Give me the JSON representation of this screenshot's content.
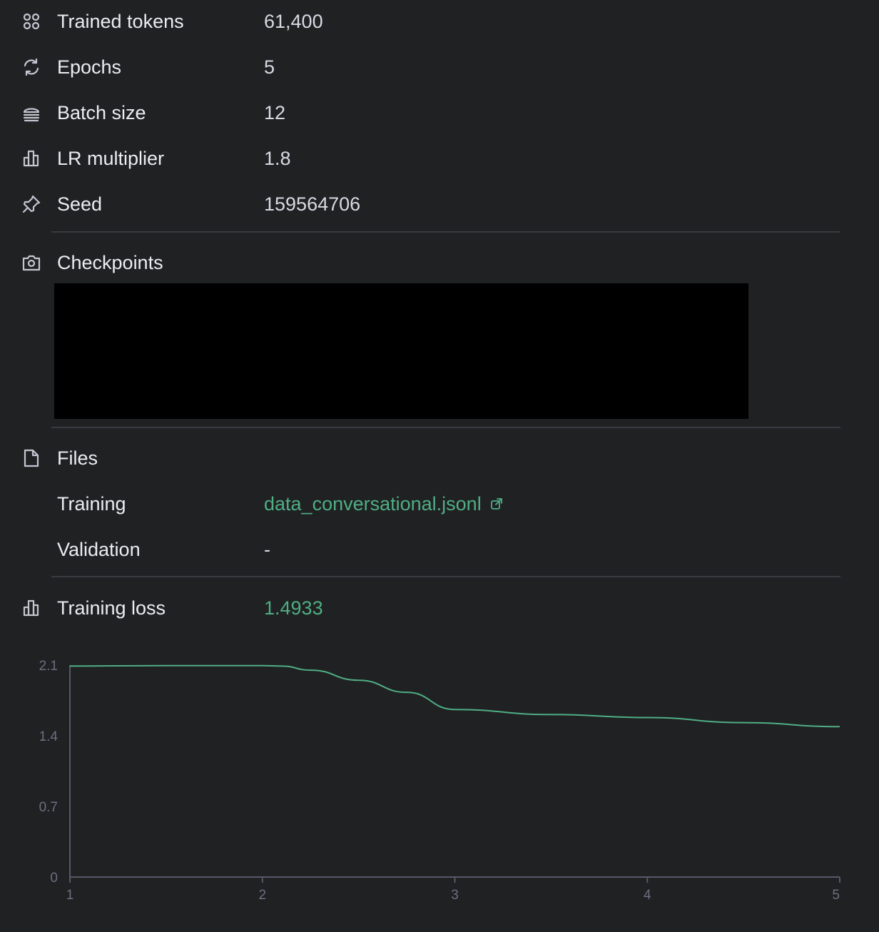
{
  "hyperparameters": {
    "trained_tokens": {
      "label": "Trained tokens",
      "value": "61,400",
      "icon": "grid-dots-icon"
    },
    "epochs": {
      "label": "Epochs",
      "value": "5",
      "icon": "refresh-icon"
    },
    "batch_size": {
      "label": "Batch size",
      "value": "12",
      "icon": "stack-icon"
    },
    "lr_multiplier": {
      "label": "LR multiplier",
      "value": "1.8",
      "icon": "bar-chart-icon"
    },
    "seed": {
      "label": "Seed",
      "value": "159564706",
      "icon": "pin-icon"
    }
  },
  "checkpoints": {
    "label": "Checkpoints",
    "icon": "camera-icon"
  },
  "files": {
    "label": "Files",
    "icon": "file-icon",
    "training_label": "Training",
    "training_file": "data_conversational.jsonl",
    "validation_label": "Validation",
    "validation_value": "-"
  },
  "training_loss": {
    "label": "Training loss",
    "value": "1.4933",
    "icon": "bar-chart-icon"
  },
  "colors": {
    "accent": "#4fae84",
    "background": "#202123",
    "line": "#4fae84"
  },
  "chart_data": {
    "type": "line",
    "title": "",
    "xlabel": "",
    "ylabel": "",
    "xlim": [
      1,
      5
    ],
    "ylim": [
      0,
      2.1
    ],
    "x_ticks": [
      "1",
      "2",
      "3",
      "4",
      "5"
    ],
    "y_ticks": [
      "0",
      "0.7",
      "1.4",
      "2.1"
    ],
    "grid": false,
    "series": [
      {
        "x": [
          1,
          1.5,
          2,
          2.1,
          2.25,
          2.5,
          2.75,
          3,
          3.5,
          4,
          4.5,
          5
        ],
        "y": [
          2.09,
          2.095,
          2.095,
          2.09,
          2.05,
          1.95,
          1.83,
          1.66,
          1.61,
          1.58,
          1.53,
          1.49
        ]
      }
    ]
  }
}
